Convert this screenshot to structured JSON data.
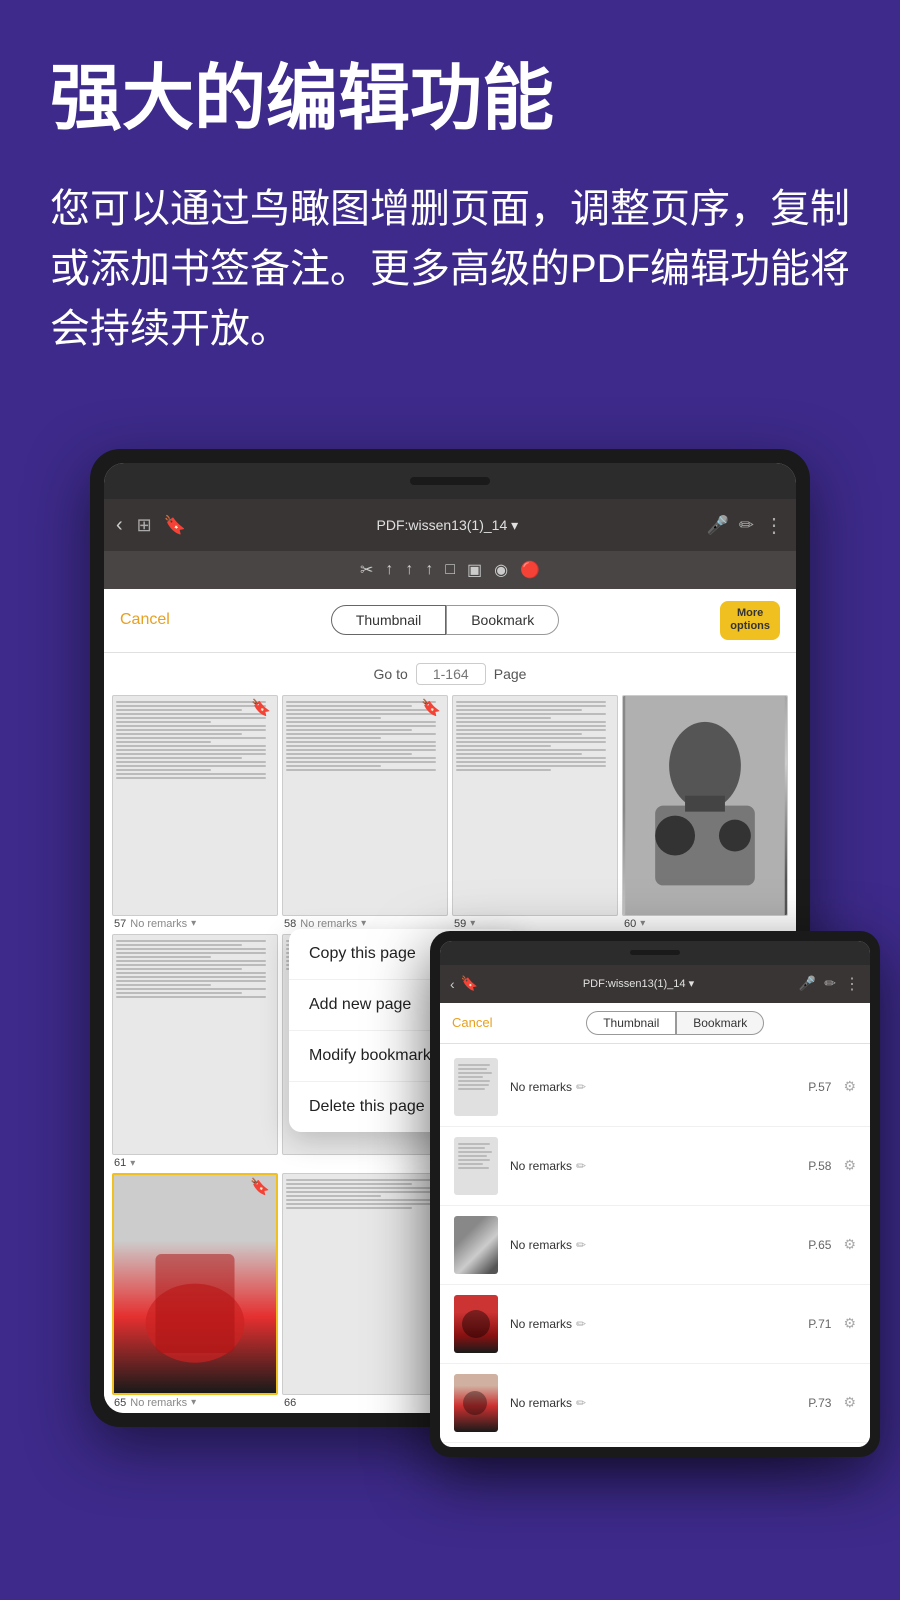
{
  "header": {
    "title": "强大的编辑功能",
    "subtitle": "您可以通过鸟瞰图增删页面，调整页序，复制或添加书签备注。更多高级的PDF编辑功能将会持续开放。"
  },
  "toolbar": {
    "title": "PDF:wissen13(1)_14",
    "dropdown_arrow": "▾",
    "back_icon": "‹",
    "grid_icon": "⊞",
    "bookmark_icon": "🔖",
    "mic_icon": "🎤",
    "pen_icon": "✏",
    "more_icon": "⋮"
  },
  "panel": {
    "cancel_label": "Cancel",
    "tab_thumbnail": "Thumbnail",
    "tab_bookmark": "Bookmark",
    "more_options_label": "More\noptions",
    "goto_label": "Go to",
    "goto_placeholder": "1-164",
    "page_label": "Page"
  },
  "context_menu": {
    "items": [
      "Copy this page",
      "Add new page",
      "Modify bookmark",
      "Delete this page"
    ]
  },
  "thumbnails": [
    {
      "number": "57",
      "remarks": "No remarks",
      "has_bookmark": true,
      "has_art": false
    },
    {
      "number": "58",
      "remarks": "No remarks",
      "has_bookmark": true,
      "has_art": false
    },
    {
      "number": "59",
      "remarks": "",
      "has_bookmark": false,
      "has_art": false
    },
    {
      "number": "60",
      "remarks": "",
      "has_bookmark": false,
      "has_art": true
    },
    {
      "number": "61",
      "remarks": "",
      "has_bookmark": false,
      "has_art": false
    },
    {
      "number": "",
      "remarks": "",
      "has_bookmark": false,
      "has_art": false
    },
    {
      "number": "",
      "remarks": "",
      "has_bookmark": false,
      "has_art": false
    },
    {
      "number": "",
      "remarks": "",
      "has_bookmark": false,
      "has_art": false
    },
    {
      "number": "65",
      "remarks": "No remarks",
      "has_bookmark": false,
      "has_art": false,
      "selected": true
    },
    {
      "number": "66",
      "remarks": "",
      "has_bookmark": false,
      "has_art": false
    }
  ],
  "second_device": {
    "toolbar_title": "PDF:wissen13(1)_14",
    "cancel_label": "Cancel",
    "tab_thumbnail": "Thumbnail",
    "tab_bookmark": "Bookmark"
  },
  "bookmark_list": [
    {
      "name": "No remarks",
      "page": "P.57",
      "has_art": false,
      "art_type": "lines"
    },
    {
      "name": "No remarks",
      "page": "P.58",
      "has_art": false,
      "art_type": "lines"
    },
    {
      "name": "No remarks",
      "page": "P.65",
      "has_art": true,
      "art_type": "art1"
    },
    {
      "name": "No remarks",
      "page": "P.71",
      "has_art": true,
      "art_type": "art2"
    },
    {
      "name": "No remarks",
      "page": "P.73",
      "has_art": true,
      "art_type": "art3"
    }
  ],
  "colors": {
    "background": "#3d2a8a",
    "accent": "#f0c020",
    "cancel": "#e8a020",
    "red": "#e53030"
  }
}
